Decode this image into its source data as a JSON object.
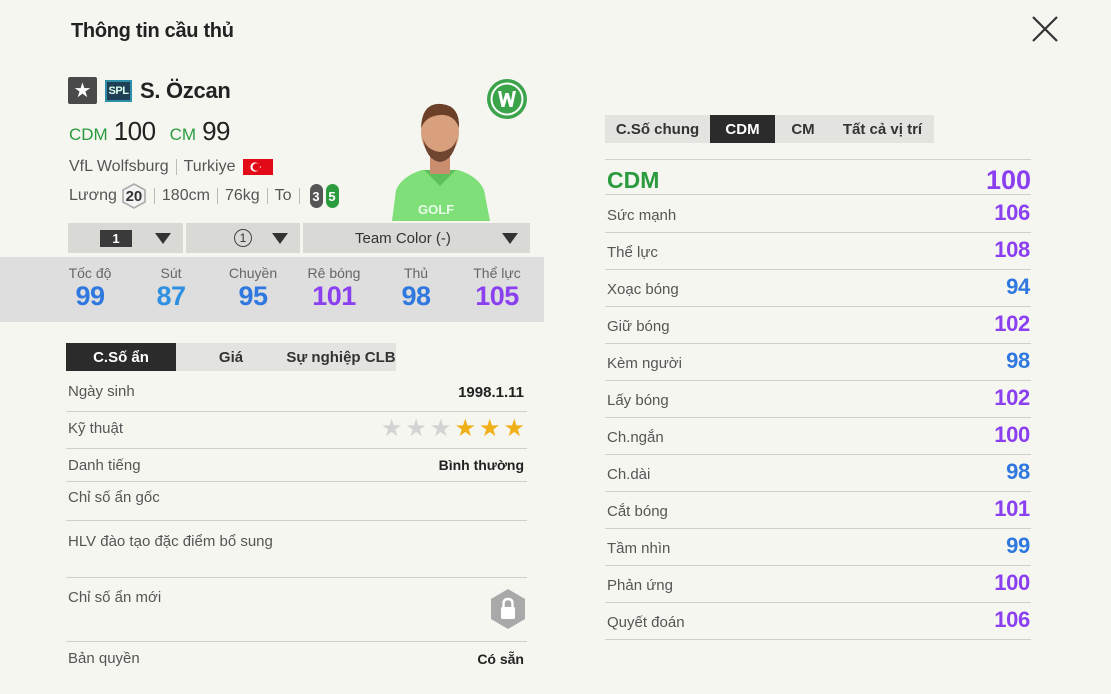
{
  "title": "Thông tin cầu thủ",
  "colors": {
    "green": "#2a9b3e",
    "purple": "#8a3ff0",
    "blue": "#2f78e0",
    "dark_tab": "#2b2b2b",
    "star_on": "#f0b019"
  },
  "player": {
    "season_badge": "SPL",
    "name": "S. Özcan",
    "positions": [
      {
        "pos": "CDM",
        "ovr": "100"
      },
      {
        "pos": "CM",
        "ovr": "99"
      }
    ],
    "club": "VfL Wolfsburg",
    "nation": "Turkiye",
    "salary_label": "Lương",
    "salary": "20",
    "height": "180cm",
    "weight": "76kg",
    "body": "To",
    "left_foot": "3",
    "right_foot": "5"
  },
  "dropdowns": {
    "grade": "1",
    "level": "1",
    "team_color": "Team Color (-)"
  },
  "main_stats": [
    {
      "label": "Tốc độ",
      "value": "99",
      "color": "#2f78e0"
    },
    {
      "label": "Sút",
      "value": "87",
      "color": "#2f8fe0"
    },
    {
      "label": "Chuyền",
      "value": "95",
      "color": "#2f78e0"
    },
    {
      "label": "Rê bóng",
      "value": "101",
      "color": "#8a3ff0"
    },
    {
      "label": "Thủ",
      "value": "98",
      "color": "#2f78e0"
    },
    {
      "label": "Thể lực",
      "value": "105",
      "color": "#8a3ff0"
    }
  ],
  "left_tabs": [
    "C.Số ẩn",
    "Giá",
    "Sự nghiệp CLB"
  ],
  "hidden": {
    "birthday_label": "Ngày sinh",
    "birthday": "1998.1.11",
    "skill_label": "Kỹ thuật",
    "skill_stars": 3,
    "reputation_label": "Danh tiếng",
    "reputation": "Bình thường",
    "orig_traits_label": "Chỉ số ẩn gốc",
    "coach_traits_label": "HLV đào tạo đặc điểm bổ sung",
    "new_traits_label": "Chỉ số ẩn mới",
    "copyright_label": "Bản quyền",
    "copyright": "Có sẵn"
  },
  "right_tabs": [
    "C.Số chung",
    "CDM",
    "CM",
    "Tất cả vị trí"
  ],
  "right_header": {
    "pos": "CDM",
    "value": "100"
  },
  "attributes": [
    {
      "label": "Sức mạnh",
      "value": "106",
      "color": "#8a3ff0"
    },
    {
      "label": "Thể lực",
      "value": "108",
      "color": "#8a3ff0"
    },
    {
      "label": "Xoạc bóng",
      "value": "94",
      "color": "#2f78e0"
    },
    {
      "label": "Giữ bóng",
      "value": "102",
      "color": "#8a3ff0"
    },
    {
      "label": "Kèm người",
      "value": "98",
      "color": "#2f78e0"
    },
    {
      "label": "Lấy bóng",
      "value": "102",
      "color": "#8a3ff0"
    },
    {
      "label": "Ch.ngắn",
      "value": "100",
      "color": "#8a3ff0"
    },
    {
      "label": "Ch.dài",
      "value": "98",
      "color": "#2f78e0"
    },
    {
      "label": "Cắt bóng",
      "value": "101",
      "color": "#8a3ff0"
    },
    {
      "label": "Tầm nhìn",
      "value": "99",
      "color": "#2f78e0"
    },
    {
      "label": "Phản ứng",
      "value": "100",
      "color": "#8a3ff0"
    },
    {
      "label": "Quyết đoán",
      "value": "106",
      "color": "#8a3ff0"
    }
  ]
}
